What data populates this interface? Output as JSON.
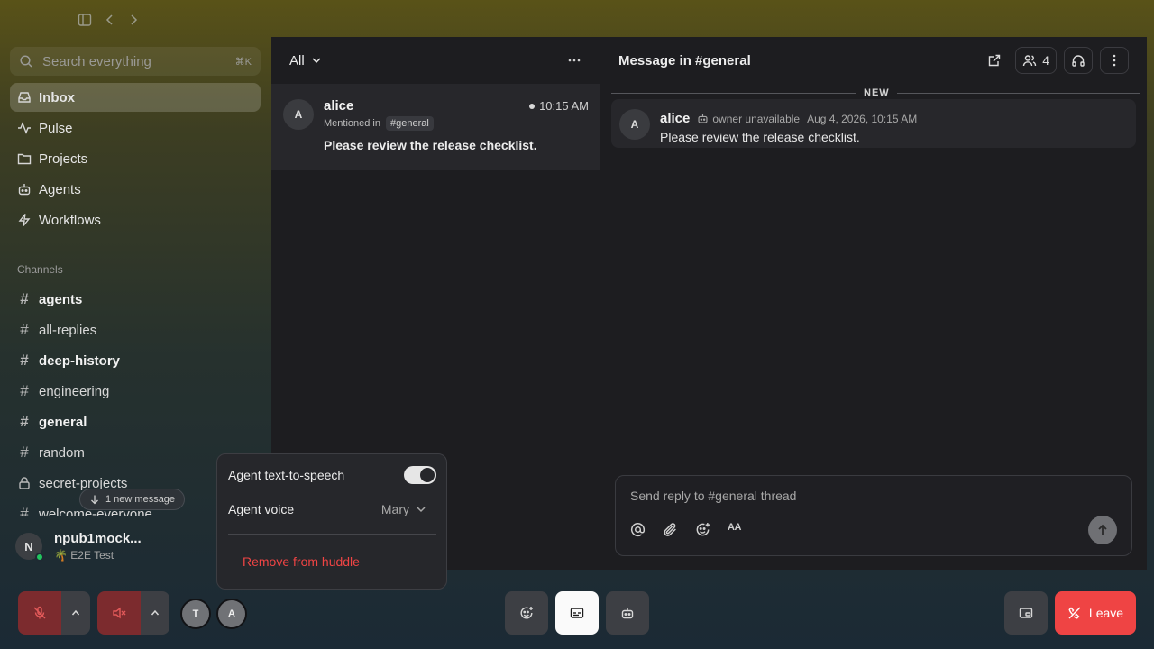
{
  "topbar": {
    "icons": [
      "sidebar-toggle-icon",
      "back-icon",
      "forward-icon"
    ]
  },
  "search": {
    "placeholder": "Search everything",
    "shortcut": "⌘K"
  },
  "nav": [
    {
      "label": "Inbox",
      "icon": "inbox-icon",
      "active": true
    },
    {
      "label": "Pulse",
      "icon": "pulse-icon"
    },
    {
      "label": "Projects",
      "icon": "folder-icon"
    },
    {
      "label": "Agents",
      "icon": "robot-icon"
    },
    {
      "label": "Workflows",
      "icon": "bolt-icon"
    }
  ],
  "channels": {
    "label": "Channels",
    "items": [
      {
        "label": "agents",
        "bold": true
      },
      {
        "label": "all-replies",
        "bold": false
      },
      {
        "label": "deep-history",
        "bold": true
      },
      {
        "label": "engineering",
        "bold": false
      },
      {
        "label": "general",
        "bold": true
      },
      {
        "label": "random",
        "bold": false
      },
      {
        "label": "secret-projects",
        "bold": false,
        "locked": true
      },
      {
        "label": "welcome-everyone",
        "bold": false
      }
    ],
    "new_message": "1 new message"
  },
  "user": {
    "initial": "N",
    "name": "npub1mock...",
    "status": "🌴 E2E Test",
    "online_color": "#22c55e"
  },
  "inbox": {
    "filter": "All",
    "items": [
      {
        "initial": "A",
        "name": "alice",
        "time": "10:15 AM",
        "mention_prefix": "Mentioned in",
        "channel": "#general",
        "preview": "Please review the release checklist."
      }
    ]
  },
  "thread": {
    "title": "Message in #general",
    "member_count": "4",
    "divider": "NEW",
    "message": {
      "initial": "A",
      "name": "alice",
      "owner": "owner unavailable",
      "date": "Aug 4, 2026, 10:15 AM",
      "text": "Please review the release checklist."
    },
    "composer": {
      "placeholder": "Send reply to #general thread",
      "format_label": "AA"
    }
  },
  "popover": {
    "tts_label": "Agent text-to-speech",
    "tts_on": true,
    "voice_label": "Agent voice",
    "voice_value": "Mary",
    "remove_label": "Remove from huddle",
    "remove_color": "#ef4444"
  },
  "huddle": {
    "participants": [
      "T",
      "A"
    ],
    "leave_label": "Leave",
    "leave_color": "#ef4444"
  }
}
